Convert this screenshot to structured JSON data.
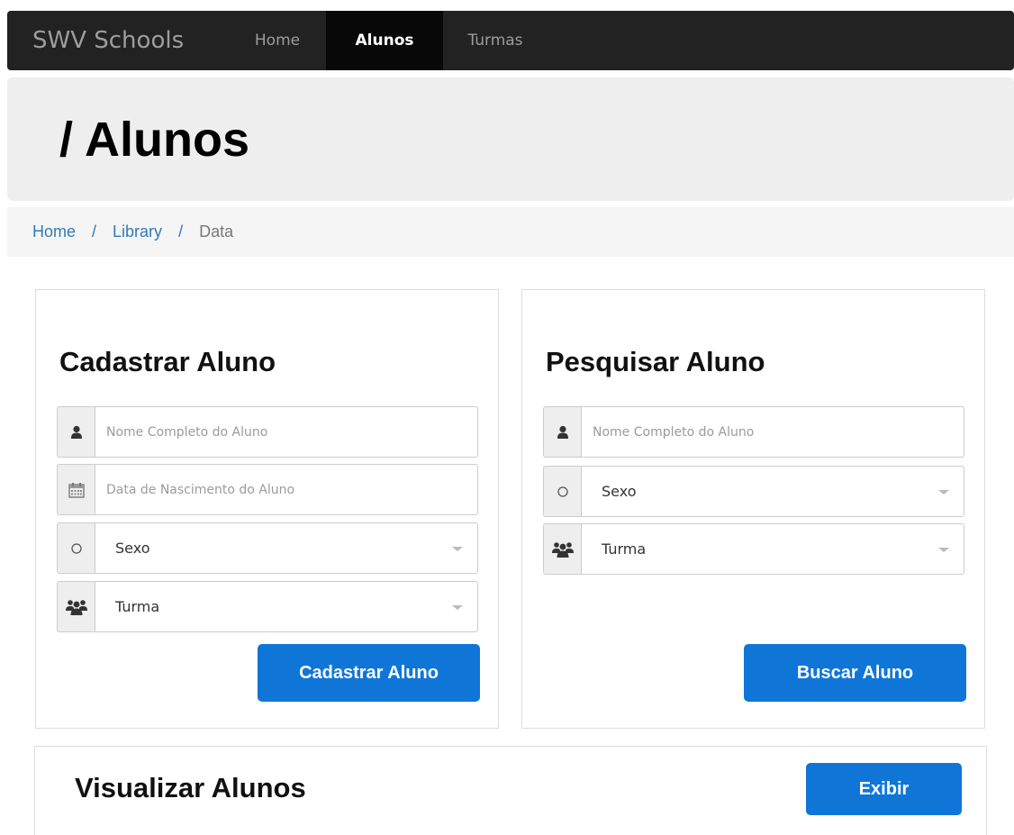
{
  "navbar": {
    "brand": "SWV Schools",
    "items": [
      {
        "label": "Home"
      },
      {
        "label": "Alunos"
      },
      {
        "label": "Turmas"
      }
    ]
  },
  "jumbotron": {
    "title": "/ Alunos"
  },
  "breadcrumb": {
    "items": [
      "Home",
      "Library",
      "Data"
    ],
    "separator": "/"
  },
  "cadastrar": {
    "title": "Cadastrar Aluno",
    "nome_placeholder": "Nome Completo do Aluno",
    "data_placeholder": "Data de Nascimento do Aluno",
    "sexo_value": "Sexo",
    "turma_value": "Turma",
    "submit_label": "Cadastrar Aluno"
  },
  "pesquisar": {
    "title": "Pesquisar Aluno",
    "nome_placeholder": "Nome Completo do Aluno",
    "sexo_value": "Sexo",
    "turma_value": "Turma",
    "submit_label": "Buscar Aluno"
  },
  "visualizar": {
    "title": "Visualizar Alunos",
    "button_label": "Exibir"
  },
  "colors": {
    "navbar_bg": "#222222",
    "accent": "#0f76d8",
    "link": "#337ab7"
  },
  "icons": {
    "user": "user-icon",
    "calendar": "calendar-icon",
    "gender": "circle-icon",
    "group": "users-icon"
  }
}
